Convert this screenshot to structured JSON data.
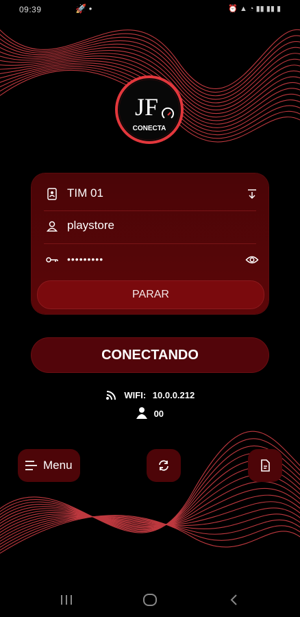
{
  "status_bar": {
    "time": "09:39"
  },
  "logo": {
    "initials": "JF",
    "brand": "CONECTA"
  },
  "login_card": {
    "server": "TIM 01",
    "username": "playstore",
    "password_mask": "•••••••••",
    "stop_label": "PARAR"
  },
  "connect_button": {
    "label": "CONECTANDO"
  },
  "info": {
    "wifi_label": "WIFI:",
    "wifi_ip": "10.0.0.212",
    "users_count": "00"
  },
  "bottom_bar": {
    "menu_label": "Menu"
  },
  "colors": {
    "accent": "#7a0a0d",
    "card": "#4a0507",
    "lines": "#e0434a"
  },
  "icons": {
    "server": "id-card-icon",
    "user": "user-icon",
    "password": "key-icon",
    "dropdown": "download-arrow-icon",
    "visibility": "eye-icon",
    "wifi": "wifi-icon",
    "users": "person-icon",
    "menu": "menu-lines-icon",
    "refresh": "refresh-icon",
    "file": "file-icon"
  }
}
